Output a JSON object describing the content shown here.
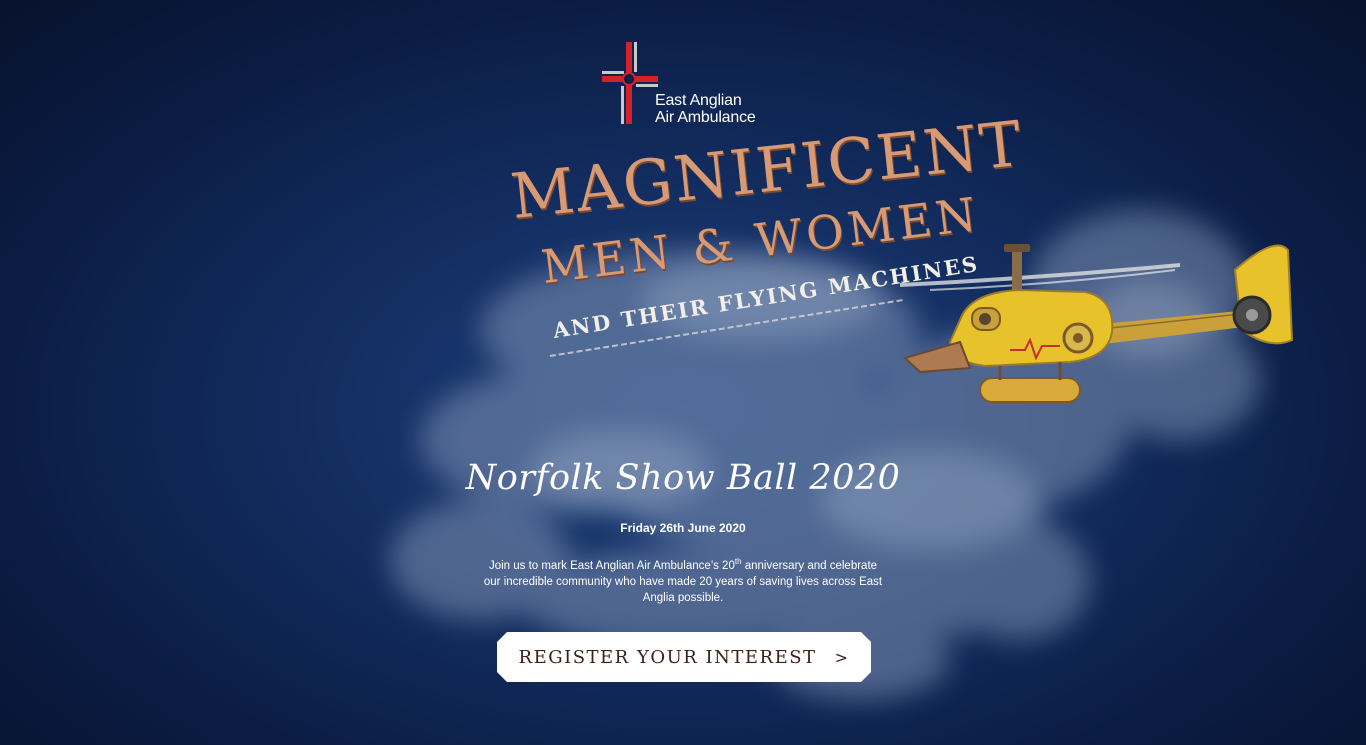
{
  "logo": {
    "line1": "East Anglian",
    "line2": "Air Ambulance"
  },
  "title_art": {
    "line1": "MAGNIFICENT",
    "line2": "MEN & WOMEN",
    "line3": "AND THEIR FLYING MACHINES"
  },
  "event": {
    "title": "Norfolk Show Ball 2020",
    "date": "Friday 26th June 2020",
    "desc_part1": "Join us to mark East Anglian Air Ambulance’s 20",
    "desc_sup": "th",
    "desc_part2": " anniversary and celebrate our incredible community who have made 20 years of saving lives across East Anglia possible."
  },
  "cta": {
    "label": "REGISTER YOUR INTEREST",
    "chevron": ">"
  },
  "colors": {
    "background_deep": "#07122d",
    "background_mid": "#142f63",
    "copper": "#d89a74",
    "logo_red": "#d4212a",
    "helicopter_yellow": "#e8c22a",
    "button_text": "#3a2218"
  },
  "icons": [
    "eaaa-cross-logo-icon",
    "helicopter-illustration",
    "chevron-right-icon"
  ]
}
